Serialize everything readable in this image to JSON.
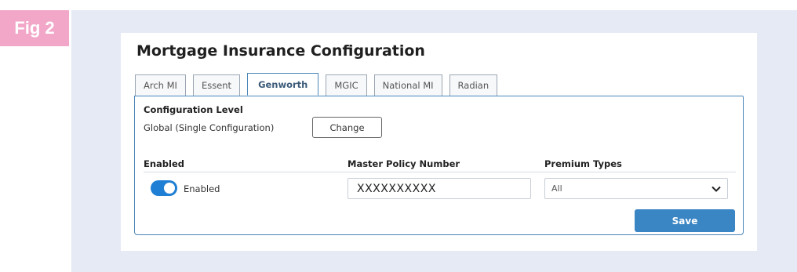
{
  "figure_label": "Fig 2",
  "title": "Mortgage Insurance Configuration",
  "tabs": [
    {
      "label": "Arch MI",
      "active": false
    },
    {
      "label": "Essent",
      "active": false
    },
    {
      "label": "Genworth",
      "active": true
    },
    {
      "label": "MGIC",
      "active": false
    },
    {
      "label": "National MI",
      "active": false
    },
    {
      "label": "Radian",
      "active": false
    }
  ],
  "config": {
    "level_label": "Configuration Level",
    "level_value": "Global (Single Configuration)",
    "change_label": "Change"
  },
  "columns": {
    "enabled": "Enabled",
    "policy": "Master Policy Number",
    "premium": "Premium Types"
  },
  "row": {
    "enabled_on": true,
    "enabled_label": "Enabled",
    "policy_value": "XXXXXXXXXX",
    "premium_value": "All"
  },
  "save_label": "Save",
  "colors": {
    "badge": "#f2a7c9",
    "accent": "#3a85c4",
    "toggle_on": "#1f7fd4",
    "background": "#e6eaf5"
  }
}
